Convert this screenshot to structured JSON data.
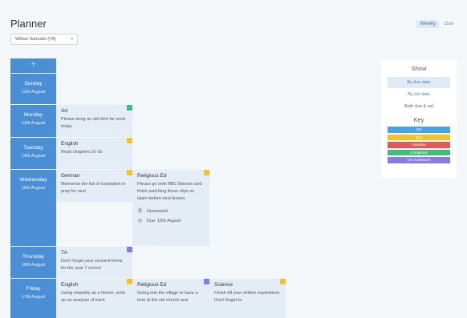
{
  "header": {
    "title": "Planner",
    "student_select": "Willow Samuels (7A)",
    "view_toggle": [
      "Weekly",
      "Due"
    ]
  },
  "colors": {
    "day_blue": "#4a8fd6",
    "card_bg": "#e4edf6",
    "set": "#4aa3df",
    "due": "#f2c12e",
    "overdue": "#e05a5a",
    "completed": "#3cbf7a",
    "not_homework": "#8b7be0"
  },
  "days": [
    {
      "name": "Sunday",
      "date": "12th August"
    },
    {
      "name": "Monday",
      "date": "13th August"
    },
    {
      "name": "Tuesday",
      "date": "14th August"
    },
    {
      "name": "Wednesday",
      "date": "15th August"
    },
    {
      "name": "Thursday",
      "date": "16th August"
    },
    {
      "name": "Friday",
      "date": "17th August"
    }
  ],
  "cards": {
    "monday_art": {
      "subject": "Art",
      "desc": "Please bring an old shirt for work today.",
      "status": "completed"
    },
    "tuesday_english": {
      "subject": "English",
      "desc": "Read chapters 10-16",
      "status": "due"
    },
    "wednesday_german": {
      "subject": "German",
      "desc": "Memorise the list of translation in prep for next",
      "status": "due"
    },
    "wednesday_religious": {
      "subject": "Religious Ed",
      "desc": "Please go onto BBC bitesize and finish watching those clips on islam before next lesson.",
      "type": "Homework",
      "due": "Due: 15th August",
      "status": "due"
    },
    "thursday_7a": {
      "subject": "7A",
      "desc": "Don't forget your consent forms for the year 7 school",
      "status": "not_homework"
    },
    "friday_english": {
      "subject": "English",
      "desc": "Using empathy as a theme, write up an analysis of each",
      "status": "due"
    },
    "friday_religious": {
      "subject": "Religious Ed",
      "desc": "Going into the village to have a look at the old church and",
      "status": "not_homework"
    },
    "friday_science": {
      "subject": "Science",
      "desc": "Finish off your written experiment. Don't forget to",
      "status": "due"
    }
  },
  "sidebar": {
    "show_title": "Show",
    "options": [
      "By due date",
      "By set date",
      "Both due & set"
    ],
    "key_title": "Key",
    "key": [
      "Set",
      "Due",
      "Overdue",
      "Completed",
      "Not homework"
    ]
  }
}
